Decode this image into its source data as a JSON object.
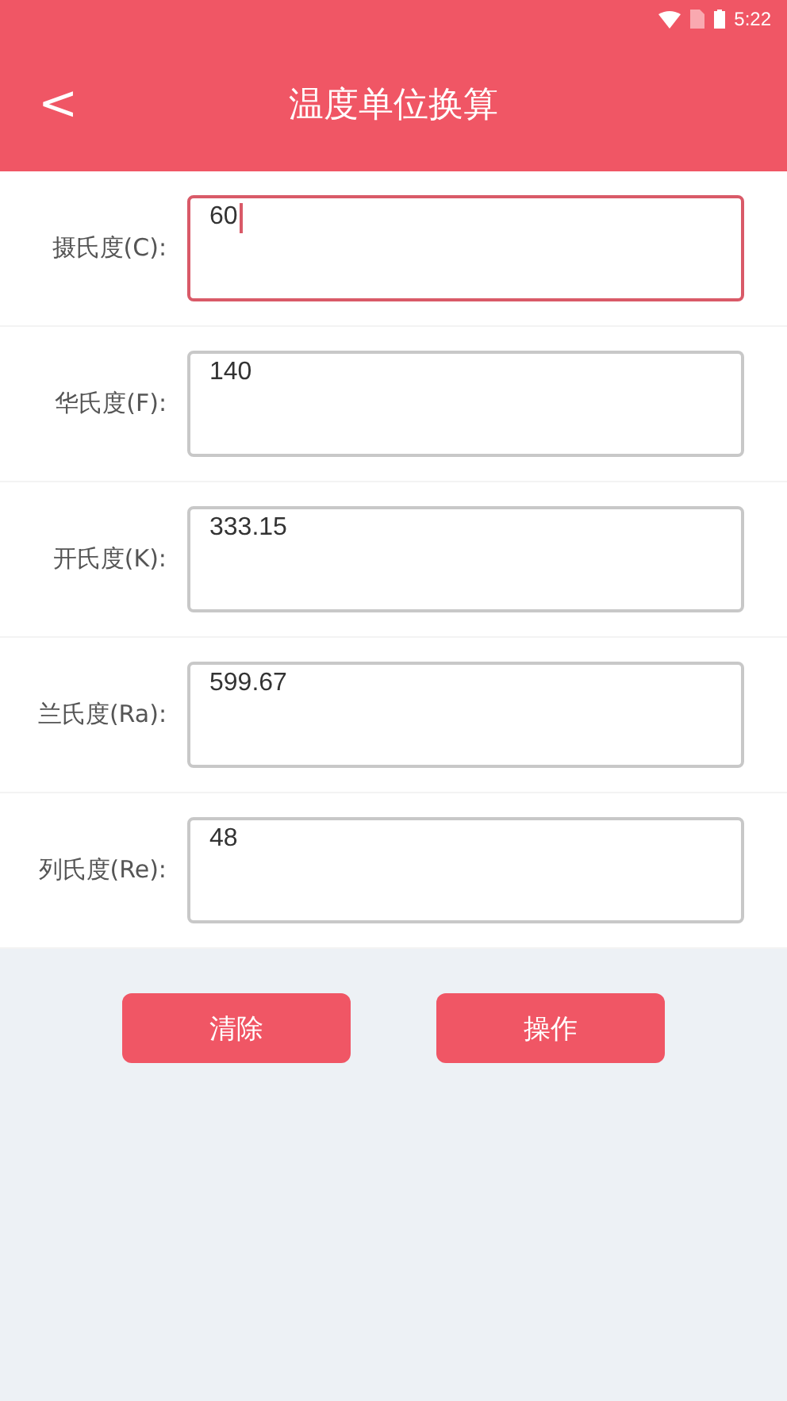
{
  "status_bar": {
    "time": "5:22"
  },
  "header": {
    "back": "<",
    "title": "温度单位换算"
  },
  "fields": [
    {
      "label": "摄氏度(C):",
      "value": "60",
      "focused": true
    },
    {
      "label": "华氏度(F):",
      "value": "140",
      "focused": false
    },
    {
      "label": "开氏度(K):",
      "value": "333.15",
      "focused": false
    },
    {
      "label": "兰氏度(Ra):",
      "value": "599.67",
      "focused": false
    },
    {
      "label": "列氏度(Re):",
      "value": "48",
      "focused": false
    }
  ],
  "buttons": [
    "清除",
    "操作"
  ]
}
